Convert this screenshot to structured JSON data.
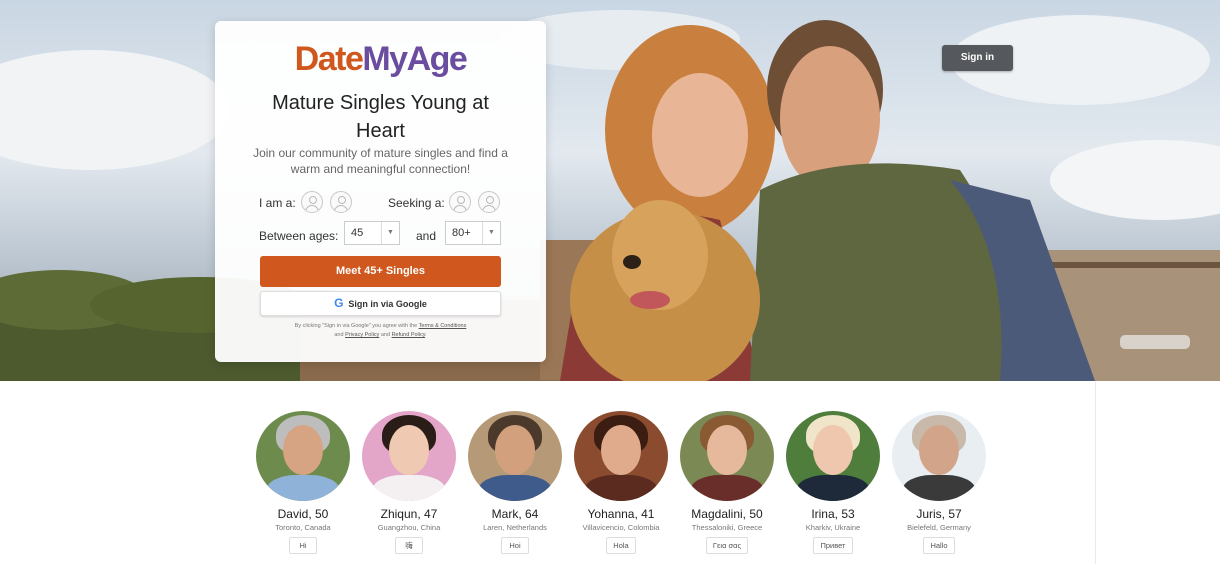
{
  "header": {
    "signin_label": "Sign in"
  },
  "brand": {
    "logo_part1": "Date",
    "logo_part2": "MyAge",
    "color1": "#d0571d",
    "color2": "#6b4da0"
  },
  "form": {
    "headline": "Mature Singles Young at Heart",
    "subline": "Join our community of mature singles and find a warm and meaningful connection!",
    "iam_label": "I am a:",
    "seeking_label": "Seeking a:",
    "between_label": "Between ages:",
    "and_label": "and",
    "age_from": "45",
    "age_to": "80+",
    "cta_label": "Meet 45+ Singles",
    "google_label": "Sign in via Google",
    "legal_pre": "By clicking \"Sign in via Google\" you agree with the",
    "legal_terms": "Terms & Conditions",
    "legal_and1": "and",
    "legal_privacy": "Privacy Policy",
    "legal_and2": "and",
    "legal_refund": "Refund Policy",
    "accent": "#d0571d"
  },
  "profiles": [
    {
      "name": "David, 50",
      "location": "Toronto, Canada",
      "greeting": "Hi"
    },
    {
      "name": "Zhiqun, 47",
      "location": "Guangzhou, China",
      "greeting": "嗨"
    },
    {
      "name": "Mark, 64",
      "location": "Laren, Netherlands",
      "greeting": "Hoi"
    },
    {
      "name": "Yohanna, 41",
      "location": "Villavicencio, Colombia",
      "greeting": "Hola"
    },
    {
      "name": "Magdalini, 50",
      "location": "Thessaloniki, Greece",
      "greeting": "Γεια σας"
    },
    {
      "name": "Irina, 53",
      "location": "Kharkiv, Ukraine",
      "greeting": "Привет"
    },
    {
      "name": "Juris, 57",
      "location": "Bielefeld, Germany",
      "greeting": "Hallo"
    }
  ]
}
